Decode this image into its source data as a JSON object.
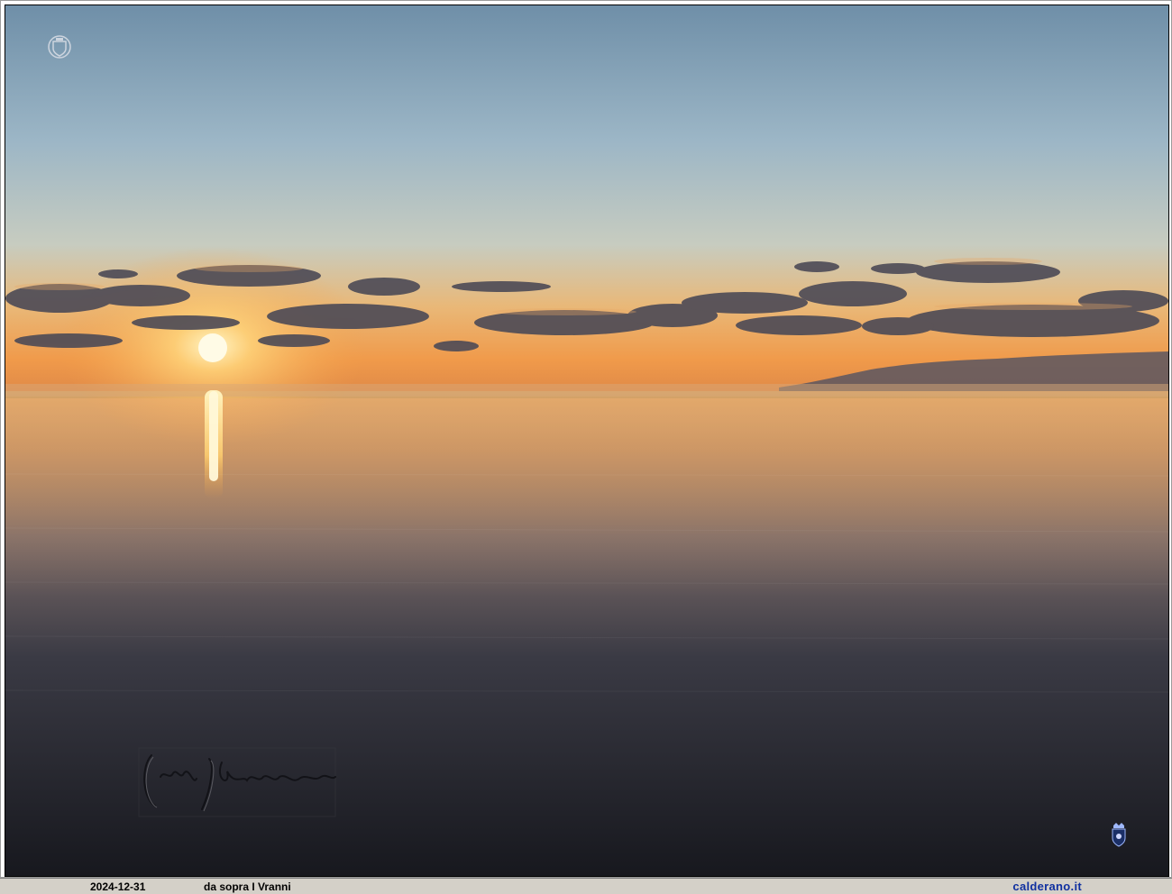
{
  "photo": {
    "subject": "sunset-over-calm-sea",
    "icons": {
      "crest_top": "coat-of-arms-icon",
      "crest_bottom": "coat-of-arms-icon",
      "signature": "signature-watermark"
    }
  },
  "caption": {
    "date": "2024-12-31",
    "title": "da sopra I Vranni",
    "site": "calderano.it"
  },
  "colors": {
    "site_link": "#1030a0",
    "caption_bg": "#d4d0c8"
  }
}
